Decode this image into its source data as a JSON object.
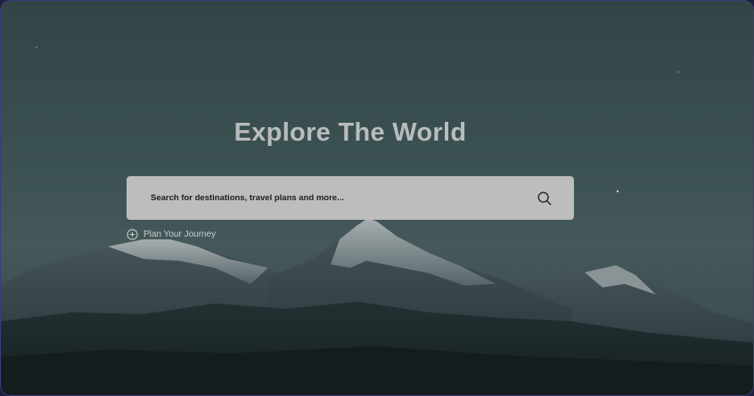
{
  "hero": {
    "title": "Explore The World"
  },
  "search": {
    "placeholder": "Search for destinations, travel plans and more...",
    "icon": "search-icon"
  },
  "plan_link": {
    "label": "Plan Your Journey",
    "icon": "plus-circle-icon"
  },
  "colors": {
    "sky": "#3b5052",
    "search_bg": "#bdbdbd",
    "frame_border": "#3b3f7a"
  }
}
